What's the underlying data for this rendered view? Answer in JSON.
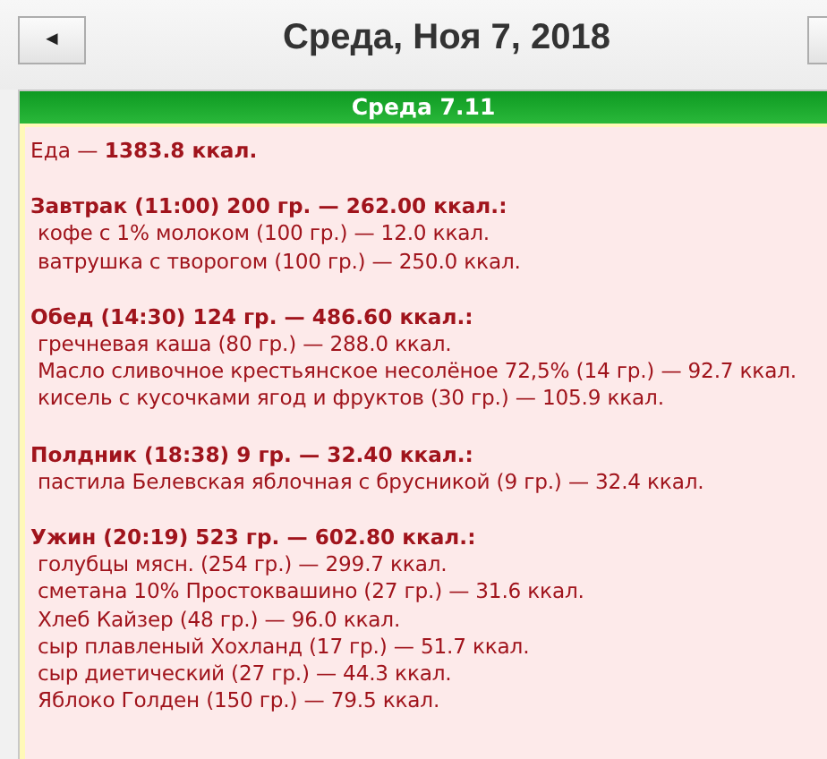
{
  "header": {
    "title": "Среда, Ноя 7, 2018",
    "prev_button": "◄"
  },
  "day": {
    "title": "Среда 7.11",
    "total": "Еда — **1383.8 ккал.**",
    "meals": [
      {
        "title": "Завтрак (11:00) 200 гр. — 262.00 ккал.:",
        "items": [
          "кофе с 1% молоком (100 гр.) — 12.0 ккал.",
          "ватрушка с творогом (100 гр.) — 250.0 ккал."
        ]
      },
      {
        "title": "Обед (14:30) 124 гр. — 486.60 ккал.:",
        "items": [
          "гречневая каша (80 гр.) — 288.0 ккал.",
          "Масло сливочное крестьянское несолёное 72,5% (14 гр.) — 92.7 ккал.",
          "кисель с кусочками ягод и фруктов (30 гр.) — 105.9 ккал."
        ]
      },
      {
        "title": "Полдник (18:38) 9 гр. — 32.40 ккал.:",
        "items": [
          "пастила Белевская яблочная с брусникой (9 гр.) — 32.4 ккал."
        ]
      },
      {
        "title": "Ужин (20:19) 523 гр. — 602.80 ккал.:",
        "items": [
          "голубцы мясн. (254 гр.) — 299.7 ккал.",
          "сметана 10% Простоквашино (27 гр.) — 31.6 ккал.",
          "Хлеб Кайзер (48 гр.) — 96.0 ккал.",
          "сыр плавленый Хохланд (17 гр.) — 51.7 ккал.",
          "сыр диетический (27 гр.) — 44.3 ккал.",
          "Яблоко Голден (150 гр.) — 79.5 ккал."
        ]
      }
    ]
  }
}
